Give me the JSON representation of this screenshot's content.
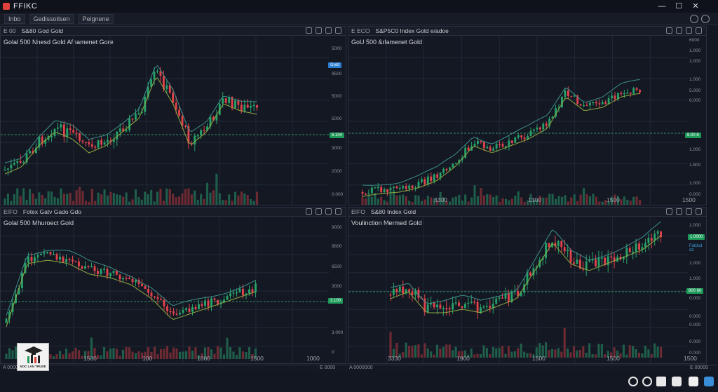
{
  "window": {
    "title": "FFIKC",
    "controls": [
      "—",
      "☐",
      "✕"
    ]
  },
  "menu": {
    "items": [
      "Inbo",
      "Gedissotisen",
      "Peignene"
    ]
  },
  "colors": {
    "bg": "#131722",
    "up": "#26a269",
    "down": "#e2434b",
    "grid": "#222837",
    "ma": "#8ea843",
    "ma2": "#3e8e88"
  },
  "panes": [
    {
      "head_tag": "E 00",
      "head_symbol": "S&80 God Gold",
      "title": "Golal 500 Nnesd Gold Afnamenet Gore",
      "prices": [
        "5000",
        "9500",
        "5000",
        "5000",
        "3000",
        "2000",
        "0.000"
      ],
      "price_badges": [
        "Gold",
        "6.104"
      ],
      "x_labels": []
    },
    {
      "head_tag": "E ECO",
      "head_symbol": "S&P5C0 Index Gold e/adoe",
      "title": "GoU 500 &rlamenet Gold",
      "prices": [
        "6000",
        "1.000",
        "1.000",
        "1.000",
        "5.000",
        "6.000",
        "1.000",
        "1.800",
        "1.000",
        "0.000"
      ],
      "price_badges": [
        "8.00 8"
      ],
      "x_labels": [
        "3300",
        "1300",
        "1500",
        "1500"
      ]
    },
    {
      "head_tag": "EIFO",
      "head_symbol": "Fotex Gatv Gado Gdo",
      "title": "Golal 500 Mhuroect Gold",
      "prices": [
        "9000",
        "9800",
        "6500",
        "3000",
        "3.000",
        "0"
      ],
      "price_badges": [
        "3.100"
      ],
      "x_labels": [
        "1500",
        "100",
        "1000",
        "1500",
        "1000"
      ]
    },
    {
      "head_tag": "EIFO",
      "head_symbol": "S&80 Index Gold",
      "title": "Voulinction Mermed Gold",
      "prices": [
        "1.000",
        "Fatdsd dz",
        "1.000",
        "1.000",
        "0.000",
        "0.000",
        "0.000",
        "0.000",
        "0.000"
      ],
      "price_badges": [
        "1.0000",
        "800 60"
      ],
      "x_labels": [
        "3330",
        "1900",
        "1500",
        "1500",
        "1500"
      ]
    }
  ],
  "footer": {
    "left": "A 0000",
    "mid_left": "E 0000",
    "mid_right": "A 0000000",
    "right": "E 00000"
  },
  "logo": {
    "text": "NOC LAN TRUDE"
  },
  "taskbar_icons": [
    "gear-icon",
    "settings-icon",
    "window-icon",
    "pin-icon",
    "document-icon",
    "app-icon"
  ]
}
